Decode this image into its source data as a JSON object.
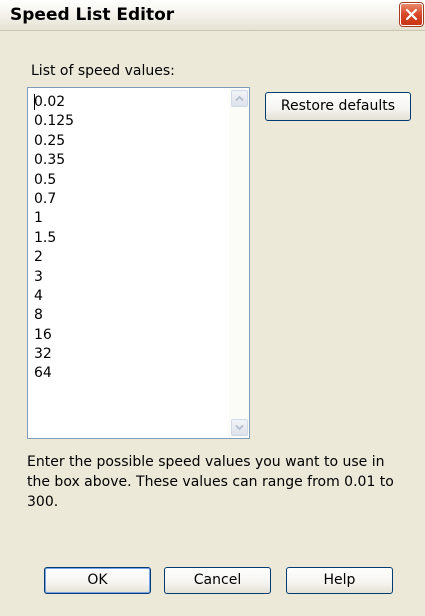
{
  "window": {
    "title": "Speed List Editor"
  },
  "list": {
    "label": "List of speed values:",
    "values": [
      "0.02",
      "0.125",
      "0.25",
      "0.35",
      "0.5",
      "0.7",
      "1",
      "1.5",
      "2",
      "3",
      "4",
      "8",
      "16",
      "32",
      "64"
    ]
  },
  "buttons": {
    "restore": "Restore defaults",
    "ok": "OK",
    "cancel": "Cancel",
    "help": "Help"
  },
  "description": "Enter the possible speed values you want to use in the box above. These values can range from 0.01 to 300.",
  "icons": {
    "close": "close-icon",
    "scroll_up": "chevron-up-icon",
    "scroll_down": "chevron-down-icon"
  },
  "colors": {
    "dialog_bg": "#ece9d8",
    "close_button": "#d9482a",
    "listbox_border": "#7f9db9",
    "button_border": "#003c74"
  }
}
